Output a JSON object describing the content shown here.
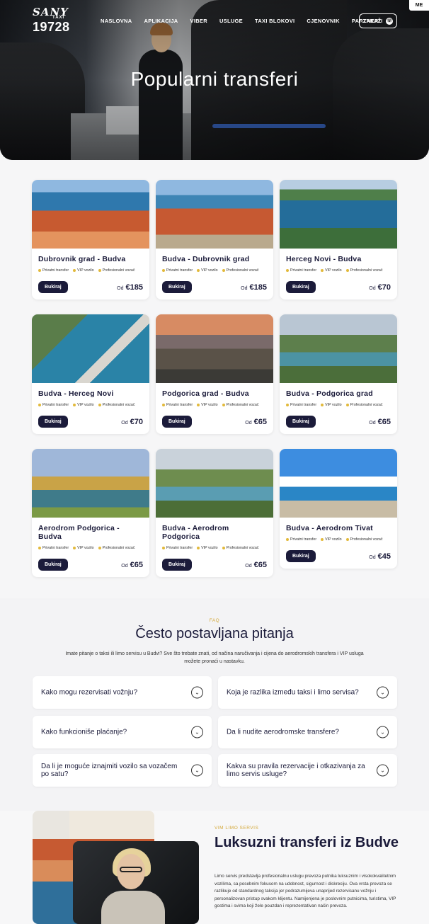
{
  "header": {
    "logo": {
      "brand": "SANY",
      "sub": "TAXI",
      "number": "19728"
    },
    "nav": [
      "NASLOVNA",
      "APLIKACIJA",
      "VIBER",
      "USLUGE",
      "TAXI BLOKOVI",
      "CJENOVNIK",
      "PARTNERI"
    ],
    "order_label": "ZAKAŽI",
    "lang": "ME"
  },
  "hero": {
    "title": "Popularni transferi"
  },
  "transfers": {
    "book_label": "Bukiraj",
    "price_prefix": "Od",
    "features": [
      "Privatni transfer",
      "VIP vozilo",
      "Profesionalni vozač"
    ],
    "items": [
      {
        "title": "Dubrovnik grad - Budva",
        "price": "€185"
      },
      {
        "title": "Budva - Dubrovnik grad",
        "price": "€185"
      },
      {
        "title": "Herceg Novi - Budva",
        "price": "€70"
      },
      {
        "title": "Budva - Herceg Novi",
        "price": "€70"
      },
      {
        "title": "Podgorica grad - Budva",
        "price": "€65"
      },
      {
        "title": "Budva - Podgorica grad",
        "price": "€65"
      },
      {
        "title": "Aerodrom Podgorica - Budva",
        "price": "€65"
      },
      {
        "title": "Budva - Aerodrom Podgorica",
        "price": "€65"
      },
      {
        "title": "Budva - Aerodrom Tivat",
        "price": "€45"
      }
    ]
  },
  "faq": {
    "tag": "FAQ",
    "title": "Često postavljana pitanja",
    "subtitle": "Imate pitanje o taksi ili limo servisu u Budvi? Sve što trebate znati, od načina naručivanja i cijena do aerodromskih transfera i VIP usluga možete pronaći u nastavku.",
    "questions": [
      "Kako mogu rezervisati vožnju?",
      "Koja je razlika između taksi i limo servisa?",
      "Kako funkcioniše plaćanje?",
      "Da li nudite aerodromske transfere?",
      "Da li je moguće iznajmiti vozilo sa vozačem po satu?",
      "Kakva su pravila rezervacije i otkazivanja za limo servis usluge?"
    ]
  },
  "limo": {
    "tag": "VIM LIMO SERVIS",
    "title": "Luksuzni transferi iz Budve",
    "text": "Limo servis predstavlja profesionalnu uslugu prevoza putnika luksuznim i visokokvalitetnim vozilima, sa posebnim fokusom na udobnost, sigurnost i diskreciju. Ova vrsta prevoza se razlikuje od standardnog taksija jer podrazumijeva unaprijed rezervisanu vožnju i personalizovan pristup svakom klijentu. Namijenjena je poslovnim putnicima, turistima, VIP gostima i svima koji žele pouzdan i reprezentativan način prevoza."
  }
}
